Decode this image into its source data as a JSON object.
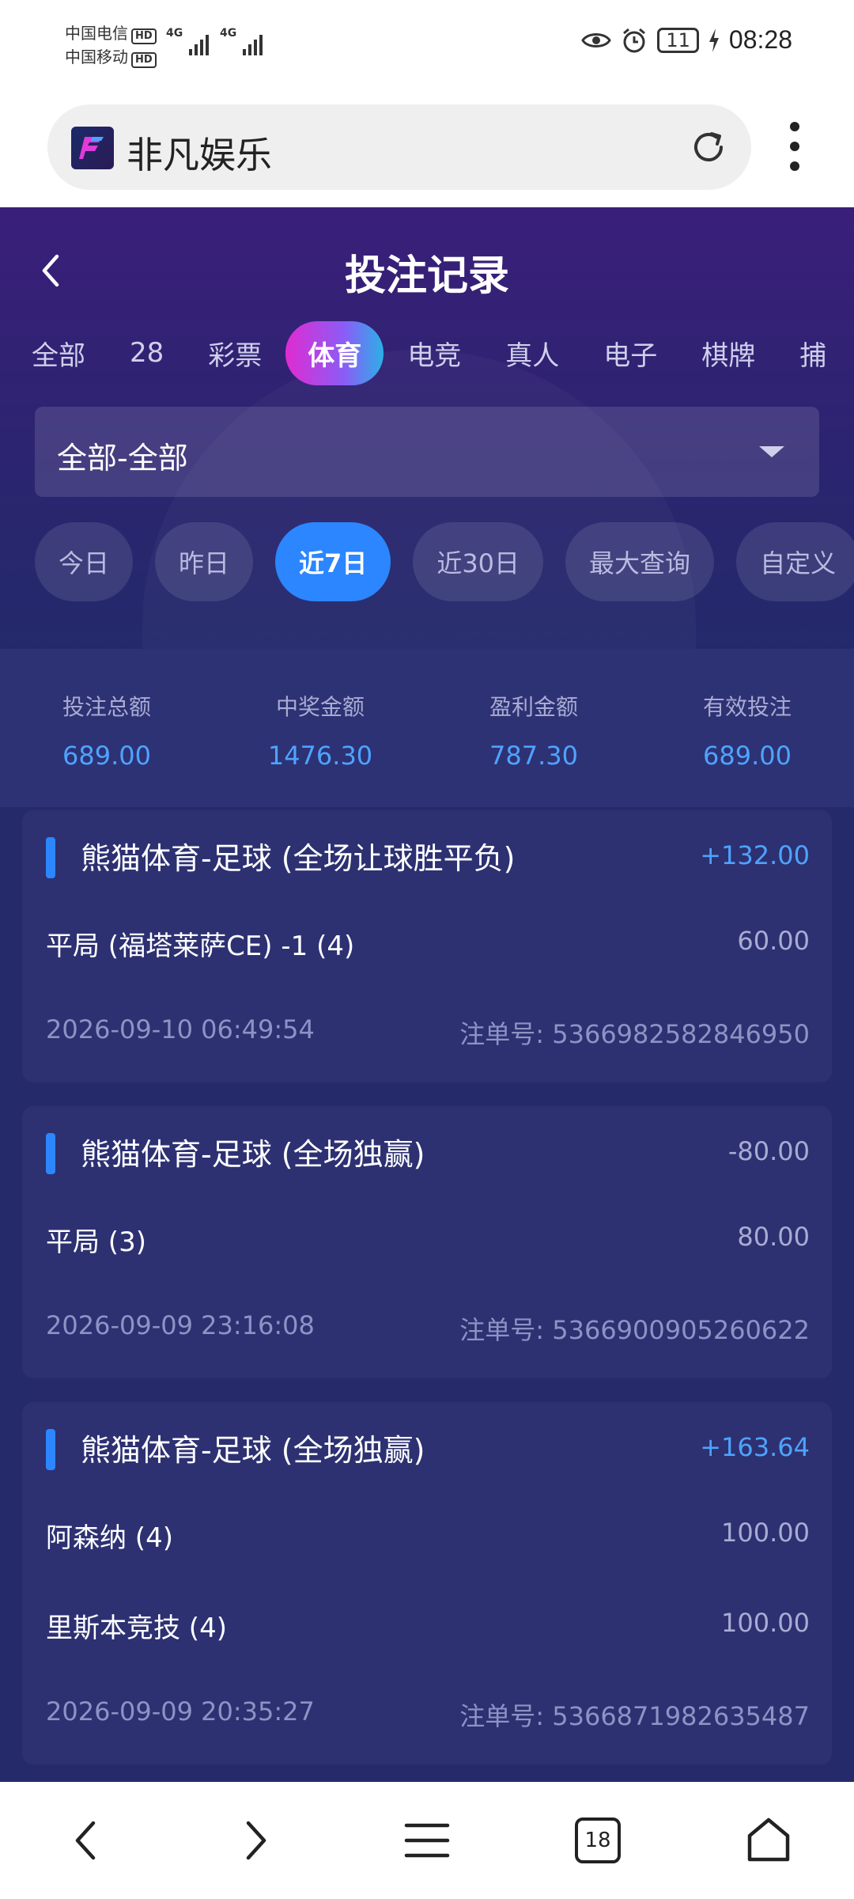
{
  "status_bar": {
    "carrier1": "中国电信",
    "carrier2": "中国移动",
    "hd": "HD",
    "net1": "4G",
    "net2": "4G",
    "battery": "11",
    "time": "08:28"
  },
  "browser": {
    "site_name": "非凡娱乐",
    "favicon_text": "非凡娱乐"
  },
  "page": {
    "title": "投注记录"
  },
  "categories": [
    "全部",
    "28",
    "彩票",
    "体育",
    "电竞",
    "真人",
    "电子",
    "棋牌",
    "捕"
  ],
  "active_category": "体育",
  "filter": {
    "value": "全部-全部"
  },
  "date_filters": [
    "今日",
    "昨日",
    "近7日",
    "近30日",
    "最大查询",
    "自定义"
  ],
  "active_date_filter": "近7日",
  "summary": [
    {
      "label": "投注总额",
      "value": "689.00"
    },
    {
      "label": "中奖金额",
      "value": "1476.30"
    },
    {
      "label": "盈利金额",
      "value": "787.30"
    },
    {
      "label": "有效投注",
      "value": "689.00"
    }
  ],
  "bets": [
    {
      "title": "熊猫体育-足球 (全场让球胜平负)",
      "result": "+132.00",
      "result_type": "positive",
      "picks": [
        {
          "name": "平局 (福塔莱萨CE) -1 (4)",
          "stake": "60.00"
        }
      ],
      "time": "2026-09-10 06:49:54",
      "order_no": "注单号: 5366982582846950"
    },
    {
      "title": "熊猫体育-足球 (全场独赢)",
      "result": "-80.00",
      "result_type": "negative",
      "picks": [
        {
          "name": "平局 (3)",
          "stake": "80.00"
        }
      ],
      "time": "2026-09-09 23:16:08",
      "order_no": "注单号: 5366900905260622"
    },
    {
      "title": "熊猫体育-足球 (全场独赢)",
      "result": "+163.64",
      "result_type": "positive",
      "picks": [
        {
          "name": "阿森纳 (4)",
          "stake": "100.00"
        },
        {
          "name": "里斯本竞技 (4)",
          "stake": "100.00"
        }
      ],
      "time": "2026-09-09 20:35:27",
      "order_no": "注单号: 5366871982635487"
    }
  ],
  "bottom_nav": {
    "tab_count": "18"
  }
}
